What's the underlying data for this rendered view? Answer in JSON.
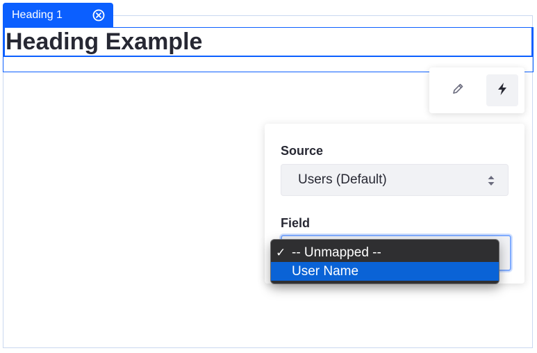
{
  "fragment": {
    "tab_label": "Heading 1",
    "close_icon": "close-circle-icon",
    "accent_color": "#0b5fff"
  },
  "heading": {
    "text": "Heading Example"
  },
  "toolbar": {
    "items": [
      {
        "icon": "pencil-icon",
        "active": false
      },
      {
        "icon": "bolt-icon",
        "active": true
      }
    ]
  },
  "mapping_panel": {
    "source": {
      "label": "Source",
      "value": "Users (Default)"
    },
    "field": {
      "label": "Field",
      "options": [
        {
          "label": "-- Unmapped --",
          "checked": true
        },
        {
          "label": "User Name",
          "highlighted": true
        }
      ]
    }
  }
}
